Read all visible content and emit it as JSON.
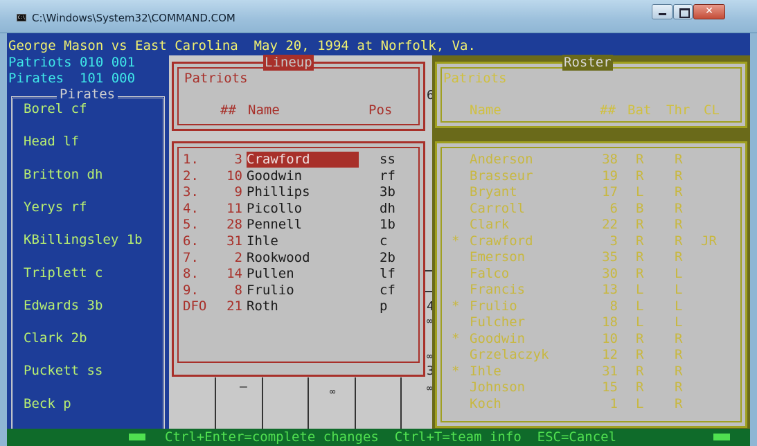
{
  "window": {
    "title": "C:\\Windows\\System32\\COMMAND.COM",
    "icon_label": "C:\\"
  },
  "header": {
    "game_line": "George Mason vs East Carolina  May 20, 1994 at Norfolk, Va.",
    "score_patriots": "Patriots 010 001",
    "score_pirates": "Pirates  101 000"
  },
  "pirates": {
    "title": "Pirates",
    "players": [
      "Borel cf",
      "Head lf",
      "Britton dh",
      "Yerys rf",
      "KBillingsley 1b",
      "Triplett c",
      "Edwards 3b",
      "Clark 2b",
      "Puckett ss",
      "Beck p"
    ]
  },
  "lineup": {
    "title": "Lineup",
    "team": "Patriots",
    "col_num": "##",
    "col_name": "Name",
    "col_pos": "Pos",
    "rows": [
      {
        "order": "1.",
        "num": "3",
        "name": "Crawford",
        "pos": "ss"
      },
      {
        "order": "2.",
        "num": "10",
        "name": "Goodwin",
        "pos": "rf"
      },
      {
        "order": "3.",
        "num": "9",
        "name": "Phillips",
        "pos": "3b"
      },
      {
        "order": "4.",
        "num": "11",
        "name": "Picollo",
        "pos": "dh"
      },
      {
        "order": "5.",
        "num": "28",
        "name": "Pennell",
        "pos": "1b"
      },
      {
        "order": "6.",
        "num": "31",
        "name": "Ihle",
        "pos": "c"
      },
      {
        "order": "7.",
        "num": "2",
        "name": "Rookwood",
        "pos": "2b"
      },
      {
        "order": "8.",
        "num": "14",
        "name": "Pullen",
        "pos": "lf"
      },
      {
        "order": "9.",
        "num": "8",
        "name": "Frulio",
        "pos": "cf"
      },
      {
        "order": "DFO",
        "num": "21",
        "name": "Roth",
        "pos": "p"
      }
    ],
    "selected_index": 0
  },
  "grid_fragments": {
    "six": "6",
    "four": "4",
    "three": "3",
    "inf1": "∞",
    "inf2": "∞",
    "inf3": "∞",
    "inf4": "∞",
    "dash": "—"
  },
  "roster": {
    "title": "Roster",
    "team": "Patriots",
    "col_name": "Name",
    "col_num": "##",
    "col_bat": "Bat",
    "col_thr": "Thr",
    "col_cl": "CL",
    "rows": [
      {
        "star": "",
        "name": "Anderson",
        "num": "38",
        "bat": "R",
        "thr": "R",
        "cl": ""
      },
      {
        "star": "",
        "name": "Brasseur",
        "num": "19",
        "bat": "R",
        "thr": "R",
        "cl": ""
      },
      {
        "star": "",
        "name": "Bryant",
        "num": "17",
        "bat": "L",
        "thr": "R",
        "cl": ""
      },
      {
        "star": "",
        "name": "Carroll",
        "num": "6",
        "bat": "B",
        "thr": "R",
        "cl": ""
      },
      {
        "star": "",
        "name": "Clark",
        "num": "22",
        "bat": "R",
        "thr": "R",
        "cl": ""
      },
      {
        "star": "*",
        "name": "Crawford",
        "num": "3",
        "bat": "R",
        "thr": "R",
        "cl": "JR"
      },
      {
        "star": "",
        "name": "Emerson",
        "num": "35",
        "bat": "R",
        "thr": "R",
        "cl": ""
      },
      {
        "star": "",
        "name": "Falco",
        "num": "30",
        "bat": "R",
        "thr": "L",
        "cl": ""
      },
      {
        "star": "",
        "name": "Francis",
        "num": "13",
        "bat": "L",
        "thr": "L",
        "cl": ""
      },
      {
        "star": "*",
        "name": "Frulio",
        "num": "8",
        "bat": "L",
        "thr": "L",
        "cl": ""
      },
      {
        "star": "",
        "name": "Fulcher",
        "num": "18",
        "bat": "L",
        "thr": "L",
        "cl": ""
      },
      {
        "star": "*",
        "name": "Goodwin",
        "num": "10",
        "bat": "R",
        "thr": "R",
        "cl": ""
      },
      {
        "star": "",
        "name": "Grzelaczyk",
        "num": "12",
        "bat": "R",
        "thr": "R",
        "cl": ""
      },
      {
        "star": "*",
        "name": "Ihle",
        "num": "31",
        "bat": "R",
        "thr": "R",
        "cl": ""
      },
      {
        "star": "",
        "name": "Johnson",
        "num": "15",
        "bat": "R",
        "thr": "R",
        "cl": ""
      },
      {
        "star": "",
        "name": "Koch",
        "num": "1",
        "bat": "L",
        "thr": "R",
        "cl": ""
      }
    ]
  },
  "status": {
    "text": "Ctrl+Enter=complete changes  Ctrl+T=team info  ESC=Cancel"
  },
  "colors": {
    "console_bg": "#1d3d98",
    "lineup_accent": "#a8302a",
    "roster_accent": "#a0a020",
    "status_bg": "#0f6b2a"
  }
}
